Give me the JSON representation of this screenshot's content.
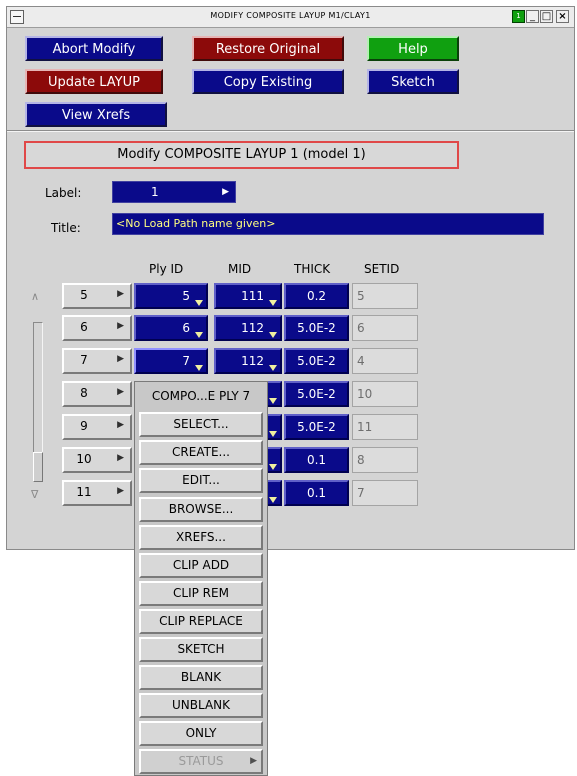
{
  "window": {
    "title": "MODIFY COMPOSITE LAYUP M1/CLAY1"
  },
  "buttons": {
    "abort": "Abort Modify",
    "restore": "Restore Original",
    "help": "Help",
    "update": "Update LAYUP",
    "copy": "Copy Existing",
    "sketch": "Sketch",
    "xrefs": "View Xrefs"
  },
  "heading": "Modify COMPOSITE LAYUP 1 (model 1)",
  "label_field": {
    "caption": "Label:",
    "value": "1"
  },
  "title_field": {
    "caption": "Title:",
    "value": "<No Load Path name given>"
  },
  "columns": {
    "ply_id": "Ply ID",
    "mid": "MID",
    "thick": "THICK",
    "setid": "SETID"
  },
  "rows": [
    {
      "num": "5",
      "ply": "5",
      "mid": "111",
      "thick": "0.2",
      "setid": "5"
    },
    {
      "num": "6",
      "ply": "6",
      "mid": "112",
      "thick": "5.0E-2",
      "setid": "6"
    },
    {
      "num": "7",
      "ply": "7",
      "mid": "112",
      "thick": "5.0E-2",
      "setid": "4"
    },
    {
      "num": "8",
      "thick": "5.0E-2",
      "setid": "10"
    },
    {
      "num": "9",
      "thick": "5.0E-2",
      "setid": "11"
    },
    {
      "num": "10",
      "thick": "0.1",
      "setid": "8"
    },
    {
      "num": "11",
      "thick": "0.1",
      "setid": "7"
    }
  ],
  "popup": {
    "title": "COMPO...E PLY 7",
    "items": [
      "SELECT...",
      "CREATE...",
      "EDIT...",
      "BROWSE...",
      "XREFS...",
      "CLIP ADD",
      "CLIP REM",
      "CLIP REPLACE",
      "SKETCH",
      "BLANK",
      "UNBLANK",
      "ONLY"
    ],
    "status": "STATUS"
  },
  "icons": {
    "menu": "window-menu-icon",
    "minimize": "minimize-icon",
    "maximize": "maximize-icon",
    "close": "close-icon",
    "dropdown": "dropdown-triangle-icon",
    "submenu": "submenu-arrow-icon",
    "scroll_up": "scroll-up-icon",
    "scroll_down": "scroll-down-icon"
  },
  "colors": {
    "button_blue": "#0a0a8a",
    "button_red": "#8c0a0a",
    "button_green": "#10a010",
    "heading_border": "#e04848",
    "title_text": "#ffff80"
  }
}
